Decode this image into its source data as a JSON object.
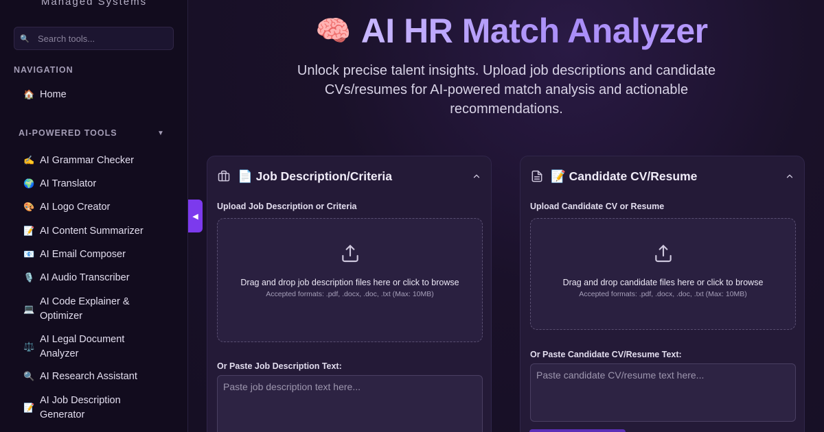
{
  "sidebar": {
    "brand_subtitle": "Managed Systems",
    "search_placeholder": "Search tools...",
    "nav_heading": "NAVIGATION",
    "home": {
      "icon": "🏠",
      "label": "Home"
    },
    "tools_heading": "AI-POWERED TOOLS",
    "tools_caret": "▼",
    "tools": [
      {
        "icon": "✍️",
        "label": "AI Grammar Checker"
      },
      {
        "icon": "🌍",
        "label": "AI Translator"
      },
      {
        "icon": "🎨",
        "label": "AI Logo Creator"
      },
      {
        "icon": "📝",
        "label": "AI Content Summarizer"
      },
      {
        "icon": "📧",
        "label": "AI Email Composer"
      },
      {
        "icon": "🎙️",
        "label": "AI Audio Transcriber"
      },
      {
        "icon": "💻",
        "label": "AI Code Explainer & Optimizer"
      },
      {
        "icon": "⚖️",
        "label": "AI Legal Document Analyzer"
      },
      {
        "icon": "🔍",
        "label": "AI Research Assistant"
      },
      {
        "icon": "📝",
        "label": "AI Job Description Generator"
      }
    ]
  },
  "collapse_glyph": "◀",
  "hero": {
    "icon": "🧠",
    "title": "AI HR Match Analyzer",
    "subtitle": "Unlock precise talent insights. Upload job descriptions and candidate CVs/resumes for AI-powered match analysis and actionable recommendations."
  },
  "job_card": {
    "title": "📄 Job Description/Criteria",
    "upload_label": "Upload Job Description or Criteria",
    "drop_text": "Drag and drop job description files here or click to browse",
    "formats": "Accepted formats: .pdf, .docx, .doc, .txt (Max: 10MB)",
    "paste_label": "Or Paste Job Description Text:",
    "paste_placeholder": "Paste job description text here..."
  },
  "cv_card": {
    "title": "📝 Candidate CV/Resume",
    "upload_label": "Upload Candidate CV or Resume",
    "drop_text": "Drag and drop candidate files here or click to browse",
    "formats": "Accepted formats: .pdf, .docx, .doc, .txt (Max: 10MB)",
    "paste_label": "Or Paste Candidate CV/Resume Text:",
    "paste_placeholder": "Paste candidate CV/resume text here..."
  },
  "colors": {
    "accent": "#7c3aed",
    "background": "#160f24",
    "card": "#241a37"
  }
}
